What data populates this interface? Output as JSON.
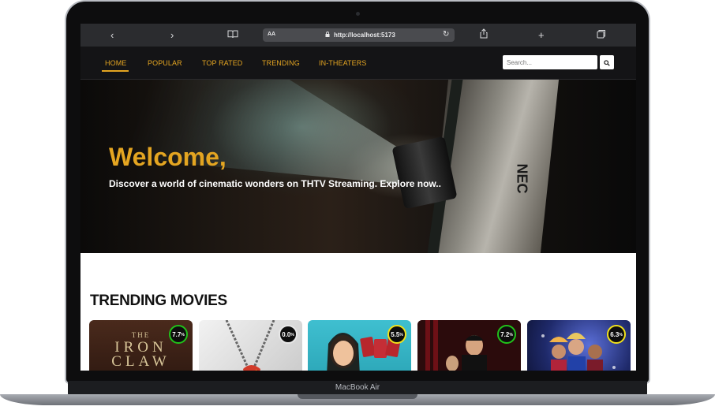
{
  "device": {
    "label": "MacBook Air"
  },
  "browser": {
    "back_icon": "chevron-left-icon",
    "forward_icon": "chevron-right-icon",
    "bookmarks_icon": "book-icon",
    "reader_label": "AA",
    "url": "http://localhost:5173",
    "reload_icon": "reload-icon",
    "share_icon": "share-icon",
    "new_tab_icon": "plus-icon",
    "tabs_icon": "tabs-icon"
  },
  "nav": {
    "items": [
      {
        "label": "HOME",
        "active": true
      },
      {
        "label": "POPULAR"
      },
      {
        "label": "TOP RATED"
      },
      {
        "label": "TRENDING"
      },
      {
        "label": "IN-THEATERS"
      }
    ],
    "search_placeholder": "Search...",
    "search_icon": "search-icon",
    "accent_color": "#e4a521"
  },
  "hero": {
    "title": "Welcome,",
    "subtitle": "Discover a world of cinematic wonders on THTV Streaming. Explore now..",
    "brand_mark": "NEC"
  },
  "trending": {
    "title": "TRENDING MOVIES",
    "movies": [
      {
        "poster_text_1": "THE",
        "poster_text_2": "IRON",
        "poster_text_3": "CLAW",
        "rating": "7.7",
        "unit": "%",
        "ring_color": "#21c21a"
      },
      {
        "rating": "0.0",
        "unit": "%",
        "ring_color": "#e8e8e8"
      },
      {
        "rating": "5.5",
        "unit": "%",
        "ring_color": "#f2e21a"
      },
      {
        "rating": "7.2",
        "unit": "%",
        "ring_color": "#21c21a"
      },
      {
        "rating": "6.3",
        "unit": "%",
        "ring_color": "#f2e21a"
      }
    ]
  }
}
